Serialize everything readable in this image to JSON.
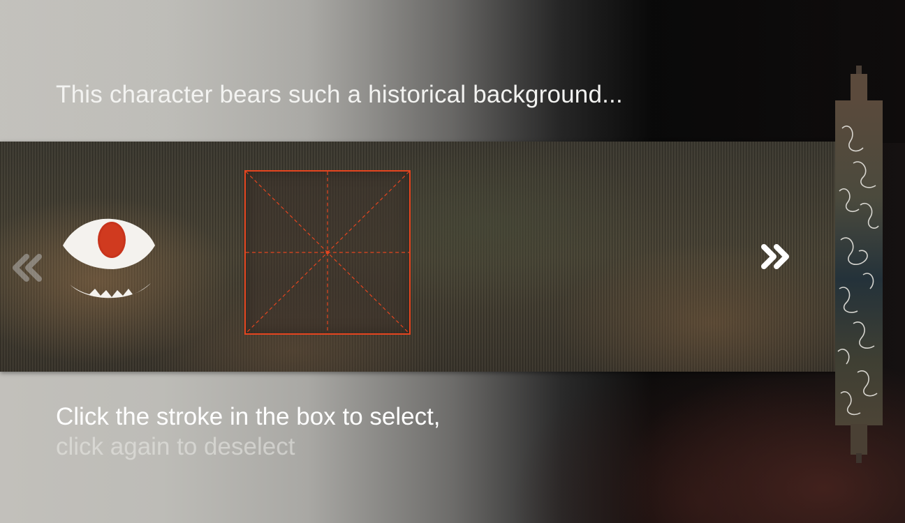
{
  "header": {
    "hint": "This character bears such a historical background..."
  },
  "navigation": {
    "prev_icon": "double-chevron-left-icon",
    "next_icon": "double-chevron-right-icon"
  },
  "character_box": {
    "guide": "rice-grid",
    "accent_color": "#e5451f"
  },
  "instructions": {
    "line1": "Click the stroke in the box to select,",
    "line2": "click again to deselect"
  },
  "colors": {
    "accent": "#e5451f",
    "eye_pupil": "#c8341c",
    "text_primary": "#ffffff"
  }
}
